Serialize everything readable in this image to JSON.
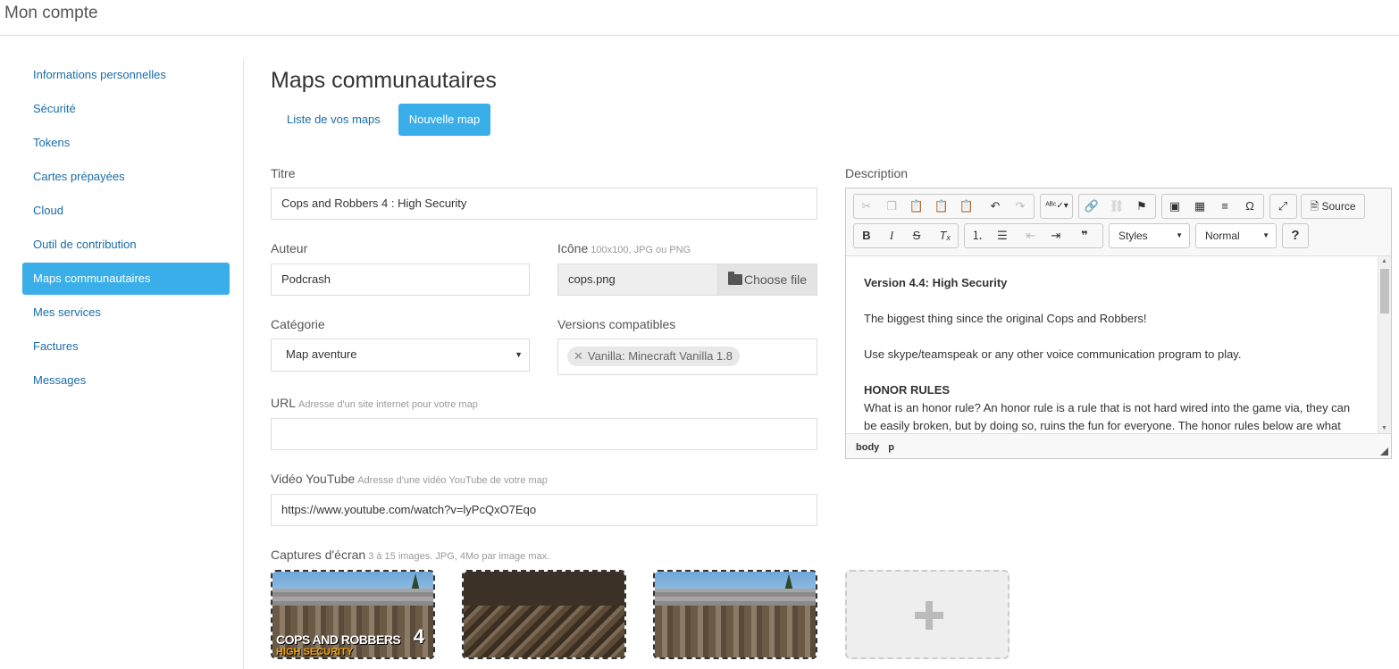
{
  "header": {
    "title": "Mon compte"
  },
  "sidebar": {
    "items": [
      {
        "label": "Informations personnelles"
      },
      {
        "label": "Sécurité"
      },
      {
        "label": "Tokens"
      },
      {
        "label": "Cartes prépayées"
      },
      {
        "label": "Cloud"
      },
      {
        "label": "Outil de contribution"
      },
      {
        "label": "Maps communautaires",
        "active": true
      },
      {
        "label": "Mes services"
      },
      {
        "label": "Factures"
      },
      {
        "label": "Messages"
      }
    ]
  },
  "main": {
    "title": "Maps communautaires",
    "tabs": [
      {
        "label": "Liste de vos maps"
      },
      {
        "label": "Nouvelle map",
        "active": true
      }
    ]
  },
  "form": {
    "titre": {
      "label": "Titre",
      "value": "Cops and Robbers 4 : High Security"
    },
    "auteur": {
      "label": "Auteur",
      "value": "Podcrash"
    },
    "icone": {
      "label": "Icône",
      "hint": "100x100, JPG ou PNG",
      "file_name": "cops.png",
      "button_label": "Choose file"
    },
    "categorie": {
      "label": "Catégorie",
      "value": "Map aventure"
    },
    "versions": {
      "label": "Versions compatibles",
      "tags": [
        "Vanilla: Minecraft Vanilla 1.8"
      ]
    },
    "url": {
      "label": "URL",
      "hint": "Adresse d'un site internet pour votre map",
      "value": ""
    },
    "video": {
      "label": "Vidéo YouTube",
      "hint": "Adresse d'une vidéo YouTube de votre map",
      "value": "https://www.youtube.com/watch?v=lyPcQxO7Eqo"
    },
    "captures": {
      "label": "Captures d'écran",
      "hint": "3 à 15 images. JPG, 4Mo par image max.",
      "logo_text": "COPS AND ROBBERS",
      "logo_number": "4",
      "logo_sub": "HIGH SECURITY"
    },
    "description": {
      "label": "Description",
      "toolbar": {
        "source_label": "Source",
        "styles_label": "Styles",
        "format_label": "Normal"
      },
      "content": {
        "heading": "Version 4.4: High Security",
        "line1": "The biggest thing since the original Cops and Robbers!",
        "line2": "Use skype/teamspeak or any other voice communication program to play.",
        "rules_heading": "HONOR RULES",
        "rules_line1": "What is an honor rule? An honor rule is a rule that is not hard wired into the game via, they can",
        "rules_line2": "be easily broken, but by doing so, ruins the fun for everyone. The honor rules below are what"
      },
      "path": [
        "body",
        "p"
      ]
    }
  },
  "colors": {
    "accent": "#3aaee8",
    "link": "#1a6ca8"
  }
}
